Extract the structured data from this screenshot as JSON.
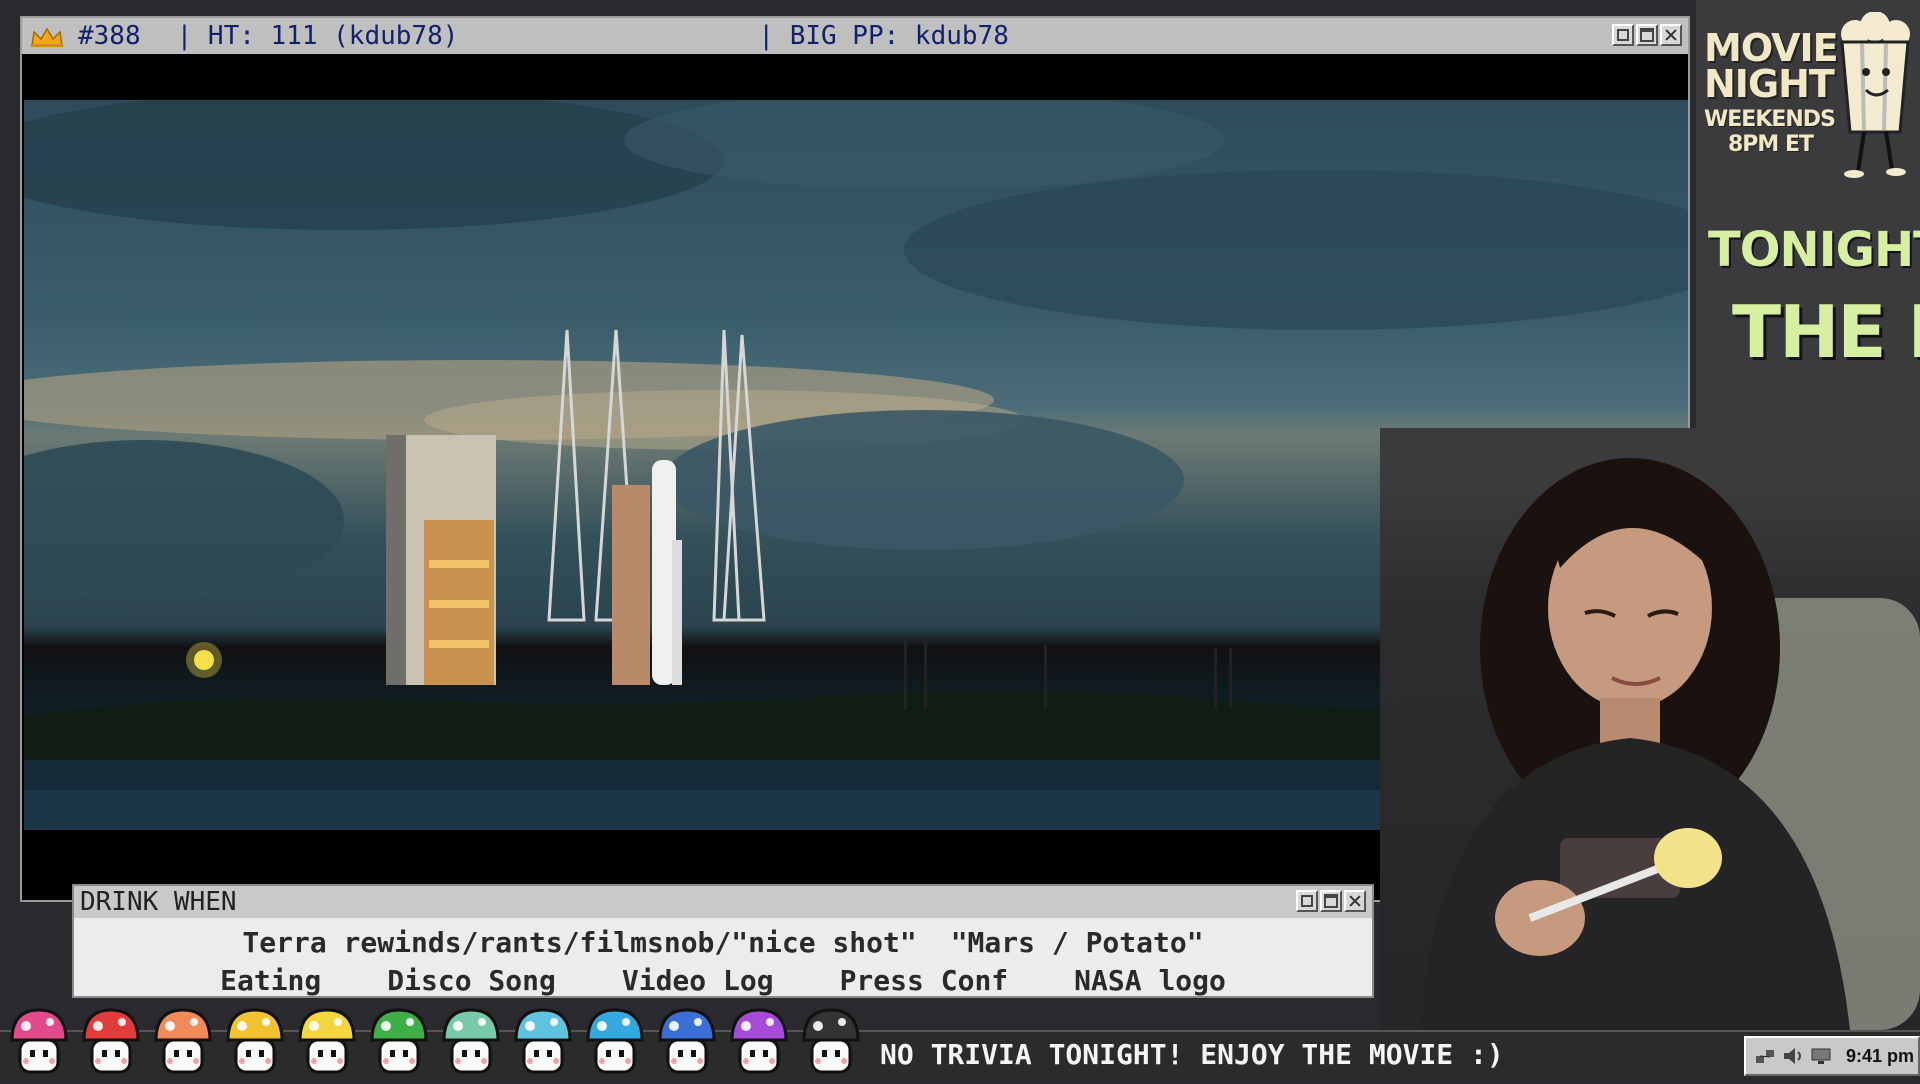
{
  "video_window": {
    "titlebar": {
      "episode": "#388",
      "ht": "| HT: 111 (kdub78)",
      "big_pp": "| BIG PP: kdub78"
    }
  },
  "sidebar": {
    "logo_line1": "MOVIE",
    "logo_line2": "NIGHT",
    "logo_line3": "WEEKENDS",
    "logo_line4": "8PM ET",
    "tonight_label": "TONIGHT:",
    "tonight_title": "THE M"
  },
  "drink_window": {
    "title": "DRINK WHEN",
    "row1": [
      "Terra rewinds/rants/filmsnob/\"nice shot\"",
      "\"Mars / Potato\""
    ],
    "row2": [
      "Eating",
      "Disco Song",
      "Video Log",
      "Press Conf",
      "NASA logo"
    ]
  },
  "taskbar": {
    "ticker": "NO TRIVIA TONIGHT! ENJOY THE MOVIE :)",
    "clock": "9:41 pm",
    "mushroom_colors": [
      "#e04a8a",
      "#e23b3b",
      "#f08a5a",
      "#f2c230",
      "#f3d640",
      "#3fae47",
      "#78c9a8",
      "#5fc3e0",
      "#34a9e0",
      "#3a6fd6",
      "#a64bd8",
      "#333333"
    ]
  }
}
